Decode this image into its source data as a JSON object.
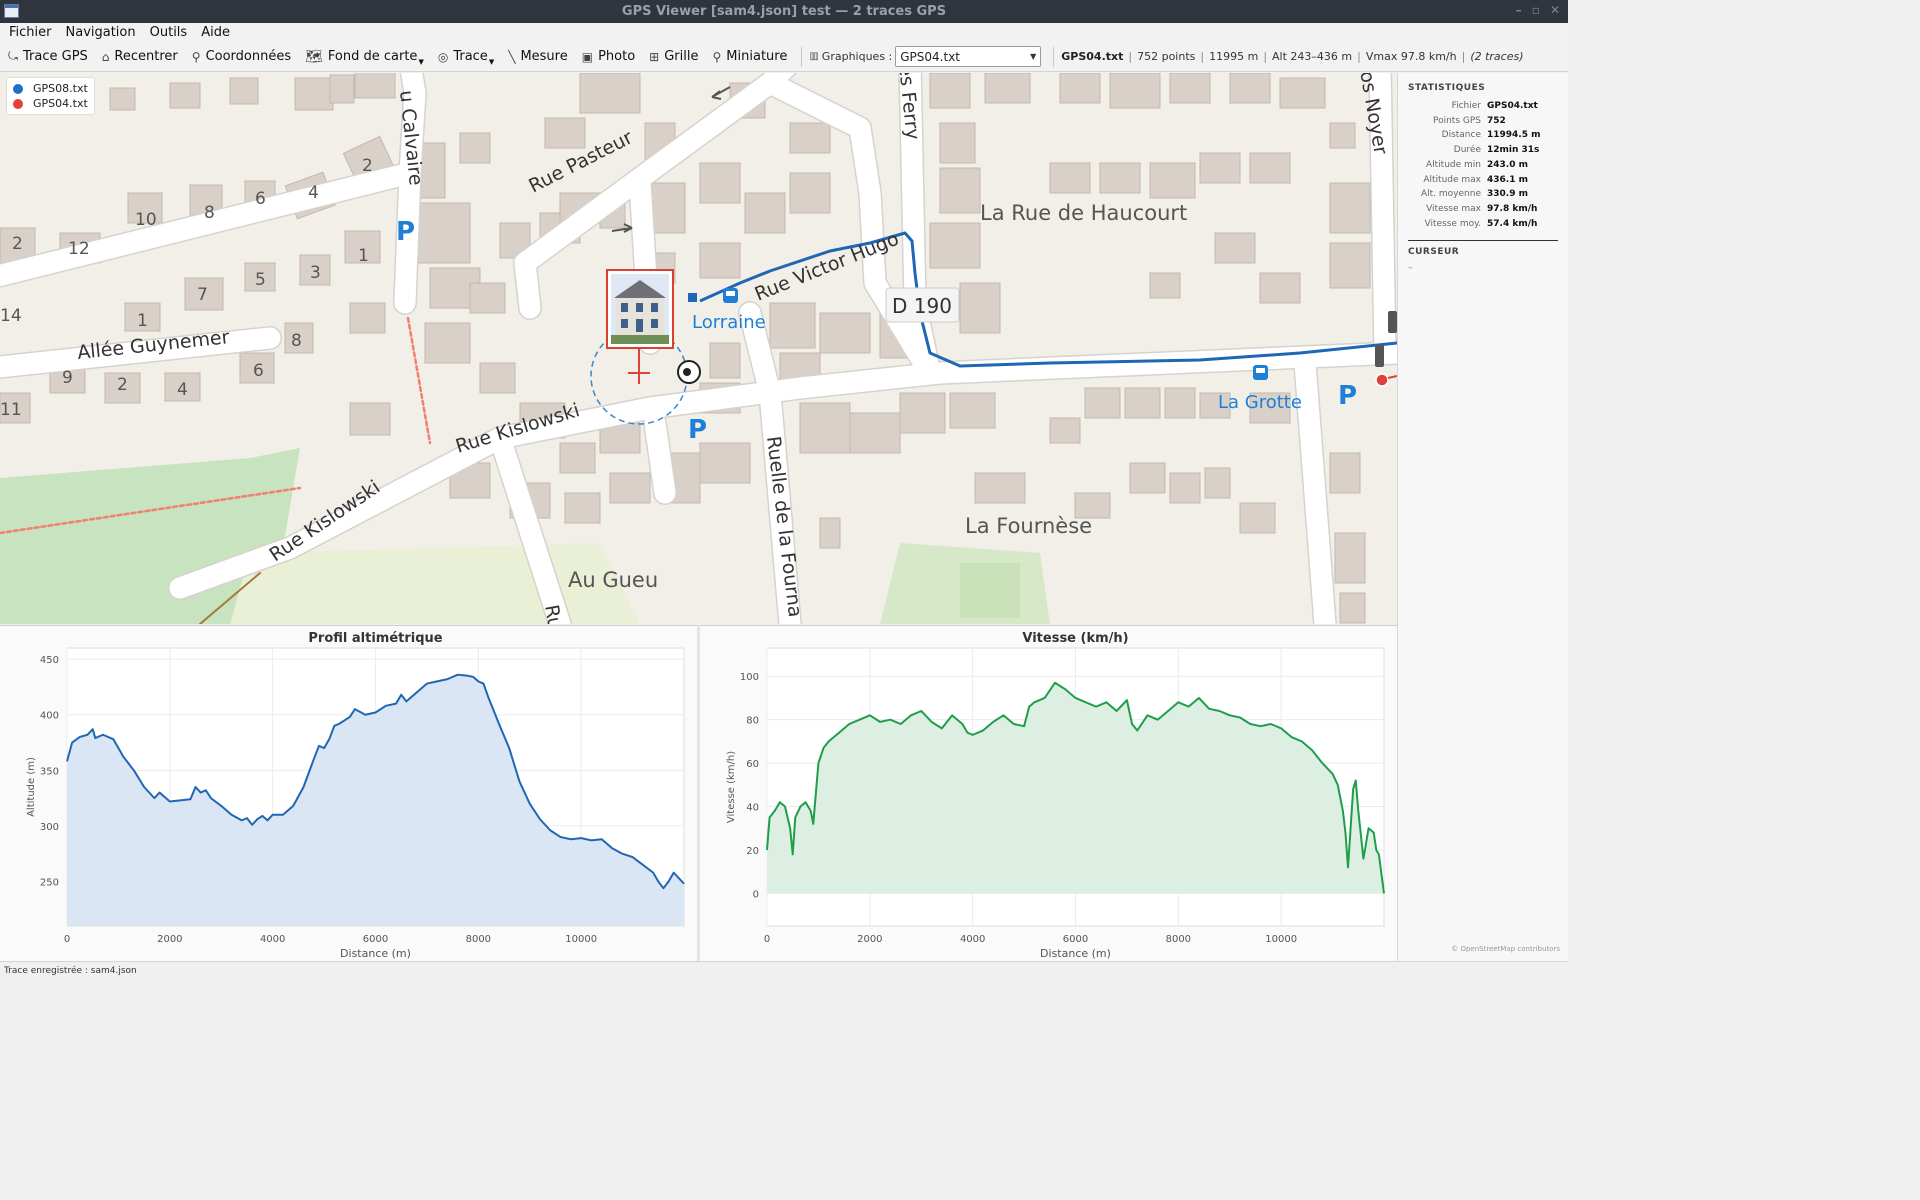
{
  "window": {
    "title": "GPS Viewer  [sam4.json]  test — 2 traces GPS"
  },
  "menu": [
    "Fichier",
    "Navigation",
    "Outils",
    "Aide"
  ],
  "toolbar": {
    "buttons": [
      {
        "label": "Trace GPS",
        "icon": "pin-icon"
      },
      {
        "label": "Recentrer",
        "icon": "home-icon"
      },
      {
        "label": "Coordonnées",
        "icon": "pushpin-icon"
      },
      {
        "label": "Fond de carte",
        "icon": "world-map-icon",
        "dropdown": true
      },
      {
        "label": "Trace",
        "icon": "trace-icon",
        "dropdown": true
      },
      {
        "label": "Mesure",
        "icon": "ruler-icon"
      },
      {
        "label": "Photo",
        "icon": "camera-icon"
      },
      {
        "label": "Grille",
        "icon": "grid-icon"
      },
      {
        "label": "Miniature",
        "icon": "magnifier-icon"
      }
    ],
    "graph_label": "Graphiques :",
    "graph_selected": "GPS04.txt",
    "info": {
      "file": "GPS04.txt",
      "points": "752 points",
      "distance": "11995 m",
      "alt": "Alt 243–436 m",
      "vmax": "Vmax 97.8 km/h",
      "traces": "(2 traces)"
    }
  },
  "legend": [
    {
      "name": "GPS08.txt",
      "color": "#1f6fc5"
    },
    {
      "name": "GPS04.txt",
      "color": "#e0413a"
    }
  ],
  "map": {
    "streets": [
      "Rue Pasteur",
      "Rue Victor Hugo",
      "Rue Kislowski",
      "Rue Kislowski",
      "Allée Guynemer",
      "Ruelle de la Fourna",
      "u Calvaire",
      "es Ferry",
      "ros Noyer",
      "Ru"
    ],
    "places": [
      "La Rue de Haucourt",
      "La Fournèse",
      "Au Gueu"
    ],
    "stops": [
      "Lorraine",
      "La Grotte"
    ],
    "road_ref": "D 190",
    "house_numbers": [
      "2",
      "6",
      "4",
      "10",
      "8",
      "2",
      "12",
      "1",
      "3",
      "5",
      "7",
      "1",
      "8",
      "14",
      "6",
      "9",
      "2",
      "4",
      "11"
    ],
    "parking": "P"
  },
  "stats": {
    "title": "STATISTIQUES",
    "rows": [
      {
        "k": "Fichier",
        "v": "GPS04.txt"
      },
      {
        "k": "Points GPS",
        "v": "752"
      },
      {
        "k": "Distance",
        "v": "11994.5 m"
      },
      {
        "k": "Durée",
        "v": "12min 31s"
      },
      {
        "k": "Altitude min",
        "v": "243.0 m"
      },
      {
        "k": "Altitude max",
        "v": "436.1 m"
      },
      {
        "k": "Alt. moyenne",
        "v": "330.9 m"
      },
      {
        "k": "Vitesse max",
        "v": "97.8 km/h"
      },
      {
        "k": "Vitesse moy.",
        "v": "57.4 km/h"
      }
    ],
    "cursor_title": "CURSEUR",
    "cursor_value": "–",
    "attribution": "© OpenStreetMap contributors"
  },
  "chart_data": [
    {
      "type": "area",
      "title": "Profil altimétrique",
      "xlabel": "Distance (m)",
      "ylabel": "Altitude (m)",
      "xlim": [
        0,
        12000
      ],
      "ylim": [
        210,
        460
      ],
      "xticks": [
        0,
        2000,
        4000,
        6000,
        8000,
        10000
      ],
      "yticks": [
        250,
        300,
        350,
        400,
        450
      ],
      "color": "#1f67b4",
      "fill": "#dae6f3",
      "x": [
        0,
        100,
        250,
        400,
        500,
        550,
        700,
        900,
        1100,
        1300,
        1500,
        1700,
        1800,
        2000,
        2200,
        2400,
        2500,
        2600,
        2700,
        2800,
        3000,
        3200,
        3400,
        3500,
        3600,
        3700,
        3800,
        3900,
        4000,
        4200,
        4400,
        4600,
        4800,
        4900,
        5000,
        5100,
        5200,
        5300,
        5500,
        5600,
        5800,
        6000,
        6200,
        6400,
        6500,
        6600,
        6800,
        7000,
        7200,
        7400,
        7600,
        7800,
        7900,
        8000,
        8100,
        8200,
        8400,
        8600,
        8800,
        9000,
        9200,
        9400,
        9600,
        9800,
        10000,
        10200,
        10400,
        10600,
        10800,
        11000,
        11200,
        11400,
        11500,
        11600,
        11700,
        11800,
        11900,
        12000
      ],
      "values": [
        358,
        375,
        380,
        382,
        387,
        379,
        382,
        378,
        362,
        350,
        335,
        325,
        330,
        322,
        323,
        324,
        335,
        330,
        332,
        325,
        318,
        310,
        305,
        307,
        301,
        306,
        309,
        305,
        310,
        310,
        318,
        335,
        360,
        372,
        370,
        378,
        390,
        392,
        398,
        405,
        400,
        402,
        408,
        410,
        418,
        412,
        420,
        428,
        430,
        432,
        436,
        435,
        434,
        430,
        428,
        415,
        392,
        370,
        340,
        320,
        306,
        296,
        290,
        288,
        289,
        287,
        288,
        280,
        275,
        272,
        265,
        258,
        250,
        244,
        250,
        258,
        253,
        248
      ]
    },
    {
      "type": "area",
      "title": "Vitesse (km/h)",
      "xlabel": "Distance (m)",
      "ylabel": "Vitesse (km/h)",
      "xlim": [
        0,
        12000
      ],
      "ylim": [
        -15,
        113
      ],
      "xticks": [
        0,
        2000,
        4000,
        6000,
        8000,
        10000
      ],
      "yticks": [
        0,
        20,
        40,
        60,
        80,
        100
      ],
      "color": "#1e9e4a",
      "fill": "#dcefe2",
      "x": [
        0,
        50,
        150,
        250,
        350,
        450,
        500,
        550,
        650,
        750,
        850,
        900,
        1000,
        1100,
        1200,
        1400,
        1600,
        1800,
        2000,
        2200,
        2400,
        2600,
        2800,
        3000,
        3200,
        3400,
        3600,
        3800,
        3900,
        4000,
        4200,
        4400,
        4600,
        4800,
        5000,
        5100,
        5200,
        5400,
        5600,
        5800,
        6000,
        6200,
        6400,
        6600,
        6800,
        7000,
        7100,
        7200,
        7400,
        7600,
        7800,
        8000,
        8200,
        8400,
        8600,
        8800,
        9000,
        9200,
        9400,
        9600,
        9800,
        10000,
        10200,
        10400,
        10600,
        10800,
        11000,
        11100,
        11200,
        11250,
        11300,
        11400,
        11450,
        11500,
        11600,
        11700,
        11800,
        11850,
        11900,
        12000
      ],
      "values": [
        20,
        35,
        38,
        42,
        40,
        30,
        18,
        35,
        40,
        42,
        38,
        32,
        60,
        67,
        70,
        74,
        78,
        80,
        82,
        79,
        80,
        78,
        82,
        84,
        79,
        76,
        82,
        78,
        74,
        73,
        75,
        79,
        82,
        78,
        77,
        86,
        88,
        90,
        97,
        94,
        90,
        88,
        86,
        88,
        84,
        89,
        78,
        75,
        82,
        80,
        84,
        88,
        86,
        90,
        85,
        84,
        82,
        81,
        78,
        77,
        78,
        76,
        72,
        70,
        66,
        60,
        55,
        50,
        38,
        28,
        12,
        48,
        52,
        38,
        16,
        30,
        28,
        20,
        18,
        0
      ]
    }
  ],
  "status": "Trace enregistrée : sam4.json"
}
